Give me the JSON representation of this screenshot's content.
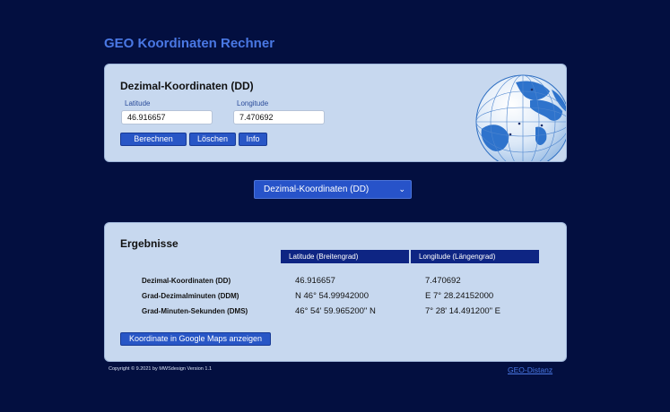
{
  "app": {
    "title": "GEO Koordinaten Rechner"
  },
  "dd_card": {
    "heading": "Dezimal-Koordinaten (DD)",
    "latitude_label": "Latitude",
    "latitude_value": "46.916657",
    "longitude_label": "Longitude",
    "longitude_value": "7.470692",
    "buttons": {
      "calculate": "Berechnen",
      "clear": "Löschen",
      "info": "Info"
    }
  },
  "format_select": {
    "selected": "Dezimal-Koordinaten (DD)",
    "icon": "chevron-down-icon"
  },
  "results": {
    "heading": "Ergebnisse",
    "columns": [
      "Latitude (Breitengrad)",
      "Longitude (Längengrad)"
    ],
    "rows": [
      {
        "label": "Dezimal-Koordinaten (DD)",
        "lat": "46.916657",
        "lon": "7.470692"
      },
      {
        "label": "Grad-Dezimalminuten (DDM)",
        "lat": "N 46° 54.99942000",
        "lon": "E 7° 28.24152000"
      },
      {
        "label": "Grad-Minuten-Sekunden (DMS)",
        "lat": "46° 54' 59.965200\" N",
        "lon": "7° 28' 14.491200\" E"
      }
    ],
    "maps_button": "Koordinate in Google Maps anzeigen"
  },
  "footer": {
    "copyright": "Copyright ©  9.2021 by MWSdesign   Version 1.1",
    "link": "GEO-Distanz"
  },
  "colors": {
    "background": "#030f40",
    "card": "#c7d8ef",
    "accent": "#2856c6",
    "title": "#4a78e4",
    "header": "#0e2583"
  }
}
